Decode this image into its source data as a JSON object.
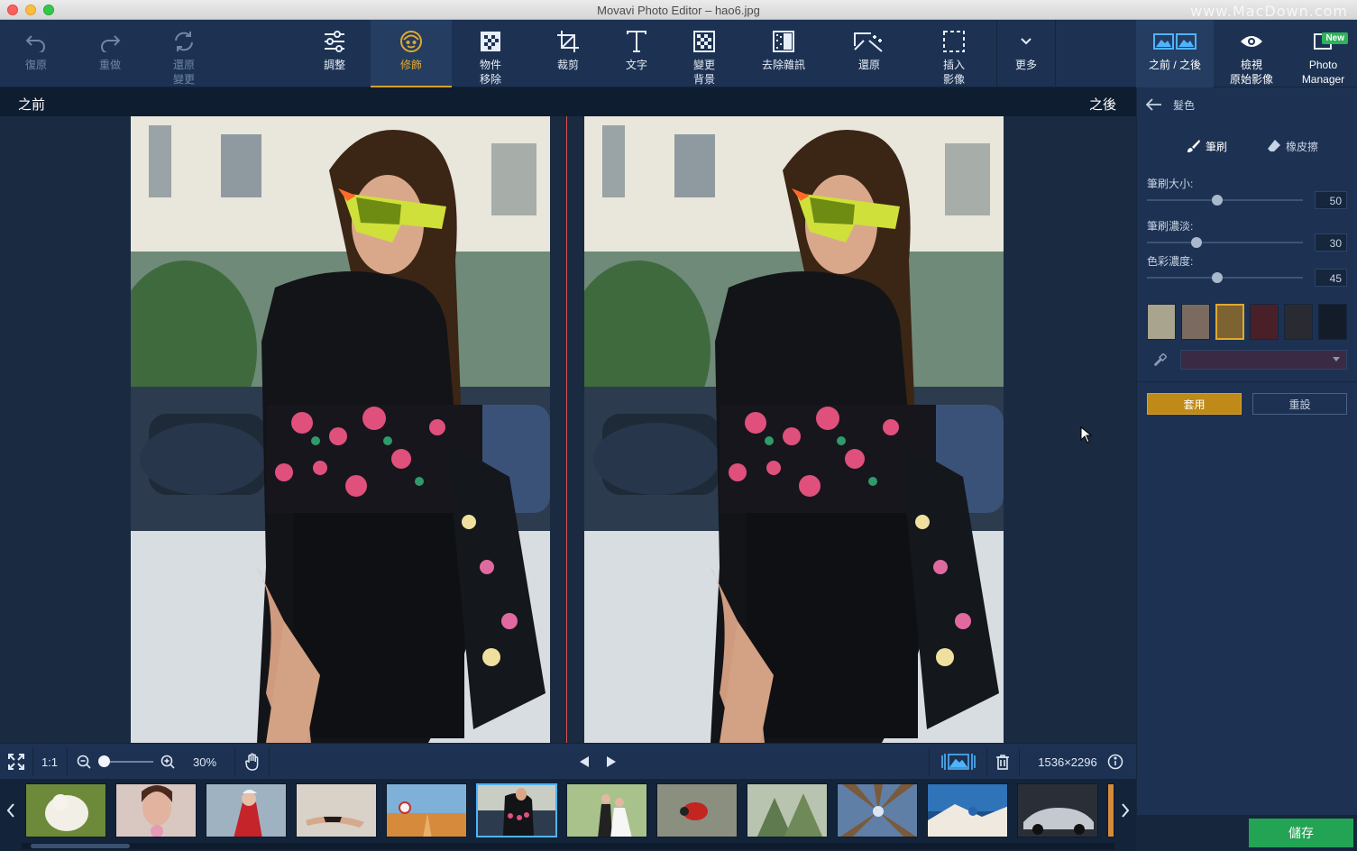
{
  "window": {
    "title": "Movavi Photo Editor – hao6.jpg",
    "watermark": "www.MacDown.com"
  },
  "toolbar": {
    "undo": "復原",
    "redo": "重做",
    "revert": "還原\n變更",
    "adjust": "調整",
    "retouch": "修飾",
    "object_removal": "物件\n移除",
    "crop": "裁剪",
    "text": "文字",
    "change_bg": "變更\n背景",
    "denoise": "去除雜訊",
    "restore": "還原",
    "insert_image": "插入\n影像",
    "more": "更多"
  },
  "rightbar": {
    "before_after": "之前 / 之後",
    "view_original": "檢視\n原始影像",
    "photo_manager": "Photo\nManager",
    "new_badge": "New"
  },
  "canvas": {
    "before_label": "之前",
    "after_label": "之後"
  },
  "bottombar": {
    "one_to_one": "1:1",
    "zoom": "30%",
    "dimensions": "1536×2296"
  },
  "panel": {
    "title": "髮色",
    "brush": "筆刷",
    "eraser": "橡皮擦",
    "sliders": [
      {
        "label": "筆刷大小:",
        "value": "50",
        "fraction": 0.45
      },
      {
        "label": "筆刷濃淡:",
        "value": "30",
        "fraction": 0.32
      },
      {
        "label": "色彩濃度:",
        "value": "45",
        "fraction": 0.45
      }
    ],
    "swatches": [
      "#a9a48d",
      "#7a6a60",
      "#7d6332",
      "#4a2028",
      "#2a2a33",
      "#141c2a"
    ],
    "selected_swatch": 2,
    "apply": "套用",
    "reset": "重設",
    "save": "儲存"
  },
  "colors": {
    "accent": "#e0a92e",
    "save_green": "#23a455",
    "split_line": "#d9534f"
  }
}
